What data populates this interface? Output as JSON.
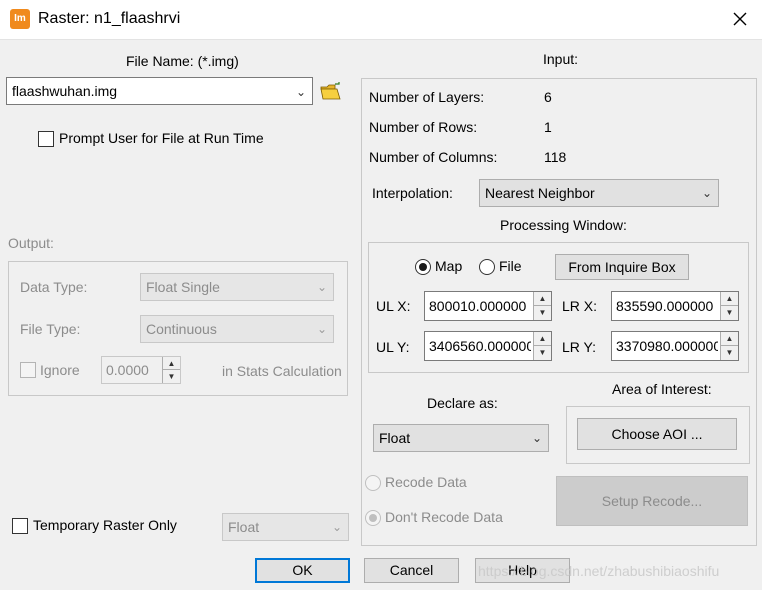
{
  "window": {
    "title": "Raster:  n1_flaashrvi",
    "icon_text": "Im",
    "close_icon": "close-icon"
  },
  "file": {
    "label": "File Name: (*.img)",
    "value": "flaashwuhan.img",
    "prompt_label": "Prompt User for File at Run Time"
  },
  "output": {
    "label": "Output:",
    "data_type_label": "Data Type:",
    "data_type_value": "Float Single",
    "file_type_label": "File Type:",
    "file_type_value": "Continuous",
    "ignore_label": "Ignore",
    "ignore_value": "0.0000",
    "stats_label": "in Stats Calculation"
  },
  "temporary": {
    "label": "Temporary Raster Only",
    "value": "Float"
  },
  "input": {
    "label": "Input:",
    "layers_label": "Number of Layers:",
    "layers_value": "6",
    "rows_label": "Number of Rows:",
    "rows_value": "1",
    "cols_label": "Number of Columns:",
    "cols_value": "118",
    "interp_label": "Interpolation:",
    "interp_value": "Nearest Neighbor",
    "processing_label": "Processing Window:",
    "map_label": "Map",
    "file_label": "File",
    "inquire_btn": "From Inquire Box",
    "ulx_label": "UL X:",
    "ulx_value": "800010.000000",
    "lrx_label": "LR X:",
    "lrx_value": "835590.000000",
    "uly_label": "UL Y:",
    "uly_value": "3406560.000000",
    "lry_label": "LR Y:",
    "lry_value": "3370980.000000"
  },
  "declare": {
    "label": "Declare as:",
    "value": "Float"
  },
  "aoi": {
    "label": "Area of Interest:",
    "button": "Choose AOI ..."
  },
  "recode": {
    "recode_label": "Recode Data",
    "dont_recode_label": "Don't Recode Data",
    "setup_button": "Setup Recode..."
  },
  "buttons": {
    "ok": "OK",
    "cancel": "Cancel",
    "help": "Help"
  },
  "watermark": "https://blog.csdn.net/zhabushibiaoshifu",
  "colors": {
    "accent": "#0078d7",
    "app_icon": "#f08a1d"
  }
}
